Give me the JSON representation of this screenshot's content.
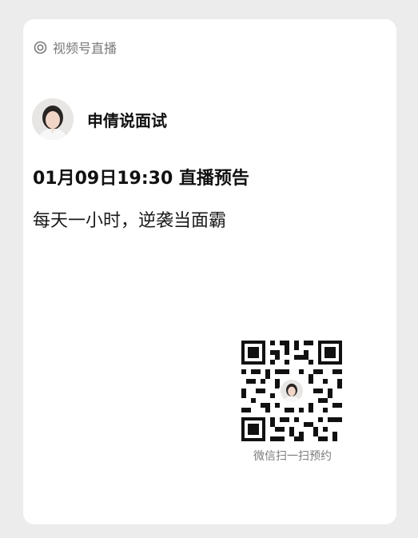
{
  "source": {
    "icon": "live-ring-icon",
    "label": "视频号直播"
  },
  "host": {
    "name": "申倩说面试",
    "avatar": "host-avatar"
  },
  "live": {
    "title": "01月09日19:30 直播预告",
    "subtitle": "每天一小时，逆袭当面霸"
  },
  "qr": {
    "caption": "微信扫一扫预约"
  },
  "colors": {
    "background": "#ececec",
    "card": "#ffffff",
    "muted_text": "#7a7a7a",
    "primary_text": "#111111"
  }
}
